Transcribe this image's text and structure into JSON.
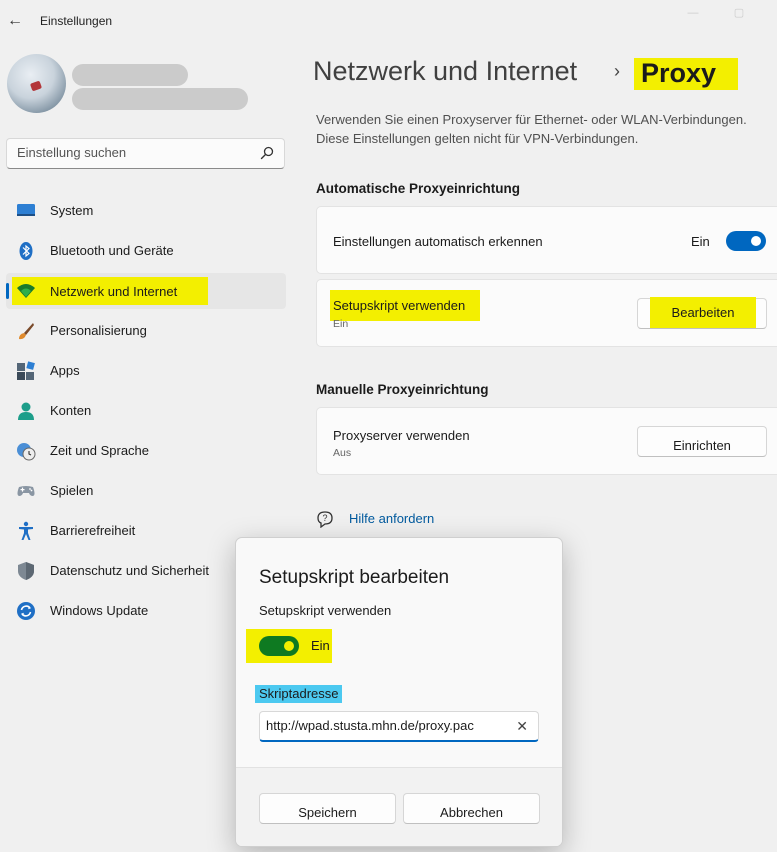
{
  "window": {
    "title": "Einstellungen",
    "back_glyph": "←",
    "minimize_glyph": "—",
    "maximize_glyph": "▢"
  },
  "sidebar": {
    "search_placeholder": "Einstellung suchen",
    "items": [
      {
        "label": "System",
        "icon": "monitor-icon"
      },
      {
        "label": "Bluetooth und Geräte",
        "icon": "bluetooth-icon"
      },
      {
        "label": "Netzwerk und Internet",
        "icon": "wifi-icon",
        "active": true
      },
      {
        "label": "Personalisierung",
        "icon": "brush-icon"
      },
      {
        "label": "Apps",
        "icon": "apps-icon"
      },
      {
        "label": "Konten",
        "icon": "person-icon"
      },
      {
        "label": "Zeit und Sprache",
        "icon": "clock-globe-icon"
      },
      {
        "label": "Spielen",
        "icon": "gamepad-icon"
      },
      {
        "label": "Barrierefreiheit",
        "icon": "accessibility-icon"
      },
      {
        "label": "Datenschutz und Sicherheit",
        "icon": "shield-icon"
      },
      {
        "label": "Windows Update",
        "icon": "update-icon"
      }
    ]
  },
  "main": {
    "breadcrumb_parent": "Netzwerk und Internet",
    "breadcrumb_sep": "›",
    "page_title": "Proxy",
    "description": "Verwenden Sie einen Proxyserver für Ethernet- oder WLAN-Verbindungen. Diese Einstellungen gelten nicht für VPN-Verbindungen.",
    "auto_section": {
      "title": "Automatische Proxyeinrichtung",
      "auto_detect_label": "Einstellungen automatisch erkennen",
      "auto_detect_state": "Ein",
      "script_label": "Setupskript verwenden",
      "script_state": "Ein",
      "script_button": "Bearbeiten"
    },
    "manual_section": {
      "title": "Manuelle Proxyeinrichtung",
      "proxy_label": "Proxyserver verwenden",
      "proxy_state": "Aus",
      "proxy_button": "Einrichten"
    },
    "help_link": "Hilfe anfordern"
  },
  "dialog": {
    "title": "Setupskript bearbeiten",
    "toggle_label": "Setupskript verwenden",
    "toggle_state": "Ein",
    "address_label": "Skriptadresse",
    "address_value": "http://wpad.stusta.mhn.de/proxy.pac",
    "save_button": "Speichern",
    "cancel_button": "Abbrechen"
  },
  "colors": {
    "accent": "#0067c0",
    "highlight_yellow": "#f3ef00",
    "highlight_blue": "#4cc9f0",
    "toggle_dialog": "#0e7a21"
  }
}
